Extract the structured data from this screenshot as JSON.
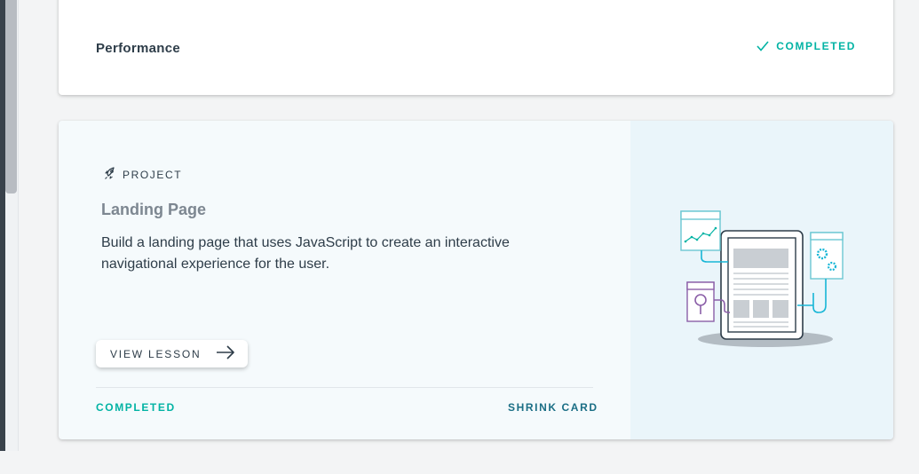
{
  "performance_card": {
    "title": "Performance",
    "status": "COMPLETED",
    "status_icon": "checkmark-icon"
  },
  "project_card": {
    "type_label": "PROJECT",
    "type_icon": "rocket-icon",
    "title": "Landing Page",
    "description": "Build a landing page that uses JavaScript to create an interactive navigational experience for the user.",
    "view_button_label": "VIEW LESSON",
    "view_button_icon": "arrow-right-icon",
    "status": "COMPLETED",
    "shrink_label": "SHRINK CARD",
    "illustration": "tablet-webpage-illustration"
  },
  "colors": {
    "accent_green": "#02b3a4",
    "link_teal": "#1a6e85",
    "text_dark": "#2e3d49",
    "text_muted": "#7d8791",
    "illus_bg": "#eaf5fa"
  }
}
